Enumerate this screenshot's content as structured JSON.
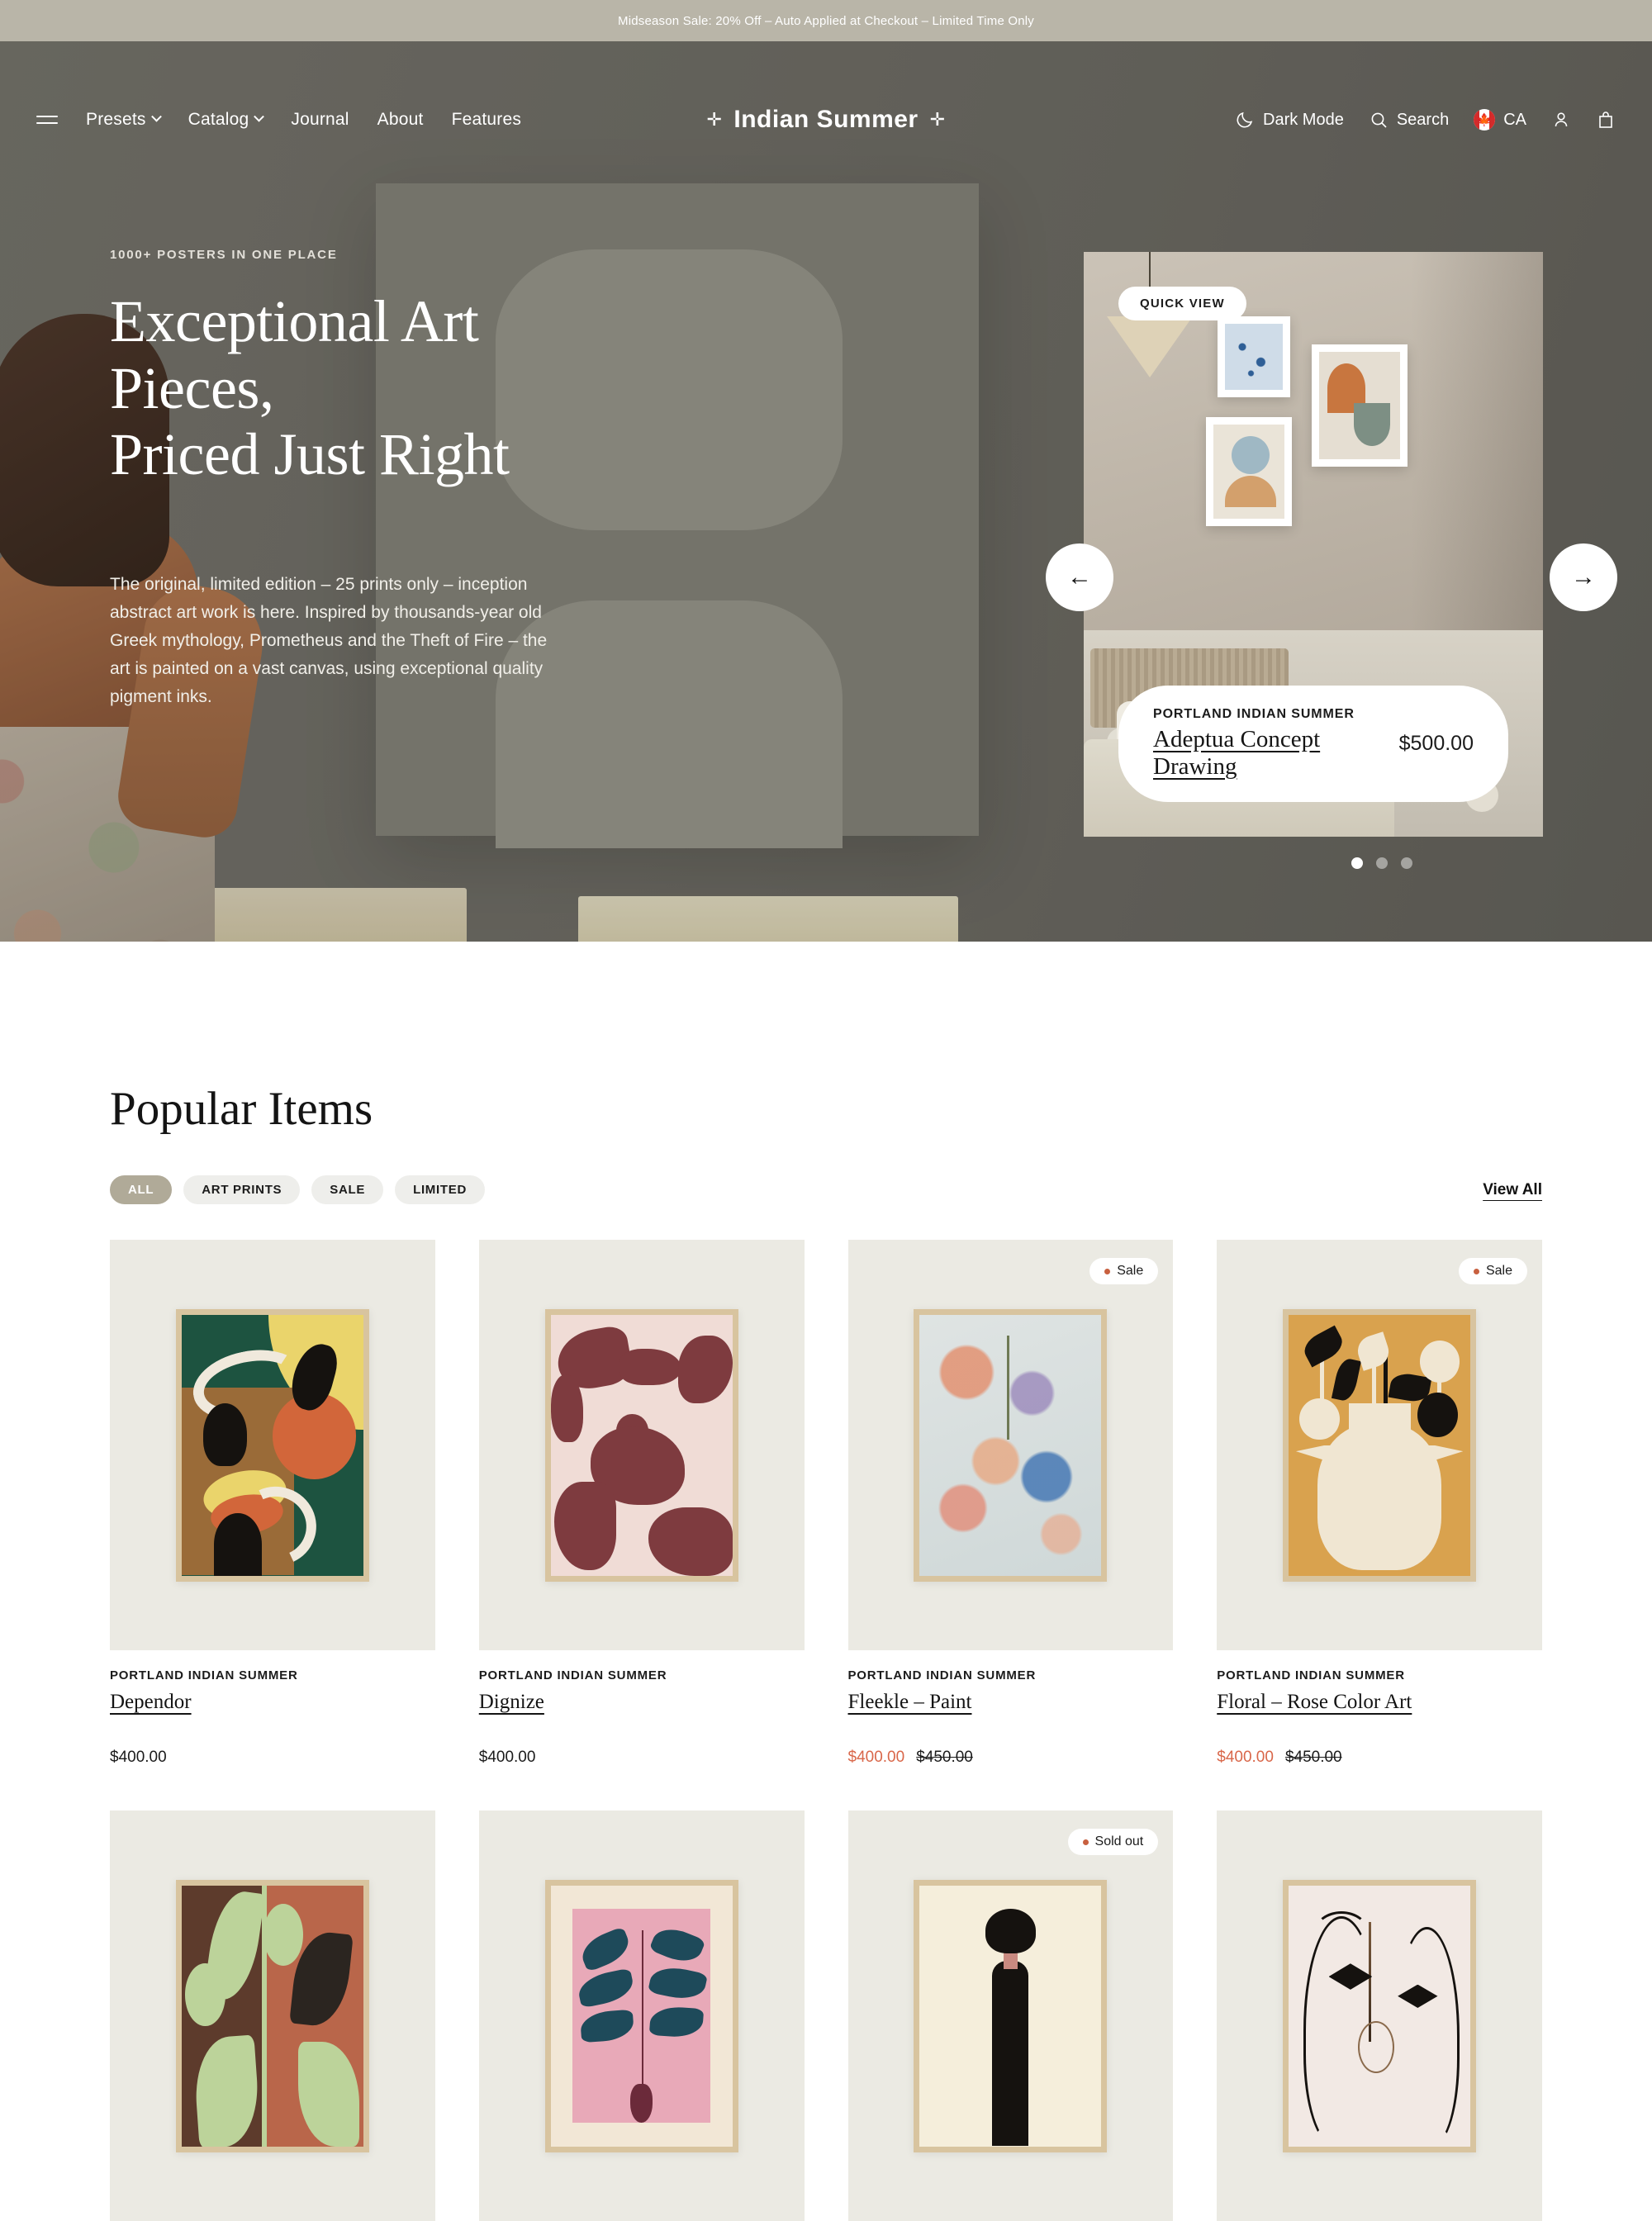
{
  "announcement": {
    "text": "Midseason Sale: 20% Off – Auto Applied at Checkout – Limited Time Only"
  },
  "header": {
    "brand": "Indian Summer",
    "brand_star": "✛",
    "menu": [
      {
        "label": "Presets",
        "has_dropdown": true
      },
      {
        "label": "Catalog",
        "has_dropdown": true
      },
      {
        "label": "Journal",
        "has_dropdown": false
      },
      {
        "label": "About",
        "has_dropdown": false
      },
      {
        "label": "Features",
        "has_dropdown": false
      }
    ],
    "utilities": {
      "dark_mode": "Dark Mode",
      "search": "Search",
      "country": "CA",
      "country_flag": "🍁"
    }
  },
  "hero": {
    "eyebrow": "1000+ POSTERS IN ONE PLACE",
    "title_line1": "Exceptional Art Pieces,",
    "title_line2": "Priced Just Right",
    "paragraph": "The original, limited edition – 25 prints only – inception abstract art work is here. Inspired by thousands-year old Greek mythology, Prometheus and the Theft of Fire – the art is painted on a vast canvas, using exceptional quality pigment inks.",
    "slide": {
      "quick_view": "QUICK VIEW",
      "vendor": "PORTLAND INDIAN SUMMER",
      "title": "Adeptua Concept Drawing",
      "price": "$500.00"
    },
    "prev_arrow": "←",
    "next_arrow": "→",
    "dots": [
      true,
      false,
      false
    ]
  },
  "popular": {
    "title": "Popular Items",
    "view_all": "View All",
    "filters": [
      {
        "label": "ALL",
        "active": true
      },
      {
        "label": "ART PRINTS",
        "active": false
      },
      {
        "label": "SALE",
        "active": false
      },
      {
        "label": "LIMITED",
        "active": false
      }
    ],
    "products": [
      {
        "vendor": "PORTLAND INDIAN SUMMER",
        "name": "Dependor",
        "price": "$400.00",
        "compare": "",
        "badge": "",
        "on_sale": false,
        "art": "a-dependor"
      },
      {
        "vendor": "PORTLAND INDIAN SUMMER",
        "name": "Dignize",
        "price": "$400.00",
        "compare": "",
        "badge": "",
        "on_sale": false,
        "art": "a-dignize"
      },
      {
        "vendor": "PORTLAND INDIAN SUMMER",
        "name": "Fleekle – Paint",
        "price": "$400.00",
        "compare": "$450.00",
        "badge": "Sale",
        "on_sale": true,
        "art": "a-fleekle"
      },
      {
        "vendor": "PORTLAND INDIAN SUMMER",
        "name": "Floral – Rose Color Art",
        "price": "$400.00",
        "compare": "$450.00",
        "badge": "Sale",
        "on_sale": true,
        "art": "a-floral"
      },
      {
        "vendor": "",
        "name": "",
        "price": "",
        "compare": "",
        "badge": "",
        "on_sale": false,
        "art": "a-leafbrown"
      },
      {
        "vendor": "",
        "name": "",
        "price": "",
        "compare": "",
        "badge": "",
        "on_sale": false,
        "art": "a-fern"
      },
      {
        "vendor": "",
        "name": "",
        "price": "",
        "compare": "",
        "badge": "Sold out",
        "on_sale": false,
        "art": "a-figure"
      },
      {
        "vendor": "",
        "name": "",
        "price": "",
        "compare": "",
        "badge": "",
        "on_sale": false,
        "art": "a-face"
      }
    ]
  },
  "colors": {
    "announcement_bg": "#b9b5a8",
    "sale_price": "#d9674a",
    "pill_active_bg": "#b0aa98",
    "thumb_bg": "#ebeae3",
    "badge_dot": "#c8603f"
  }
}
